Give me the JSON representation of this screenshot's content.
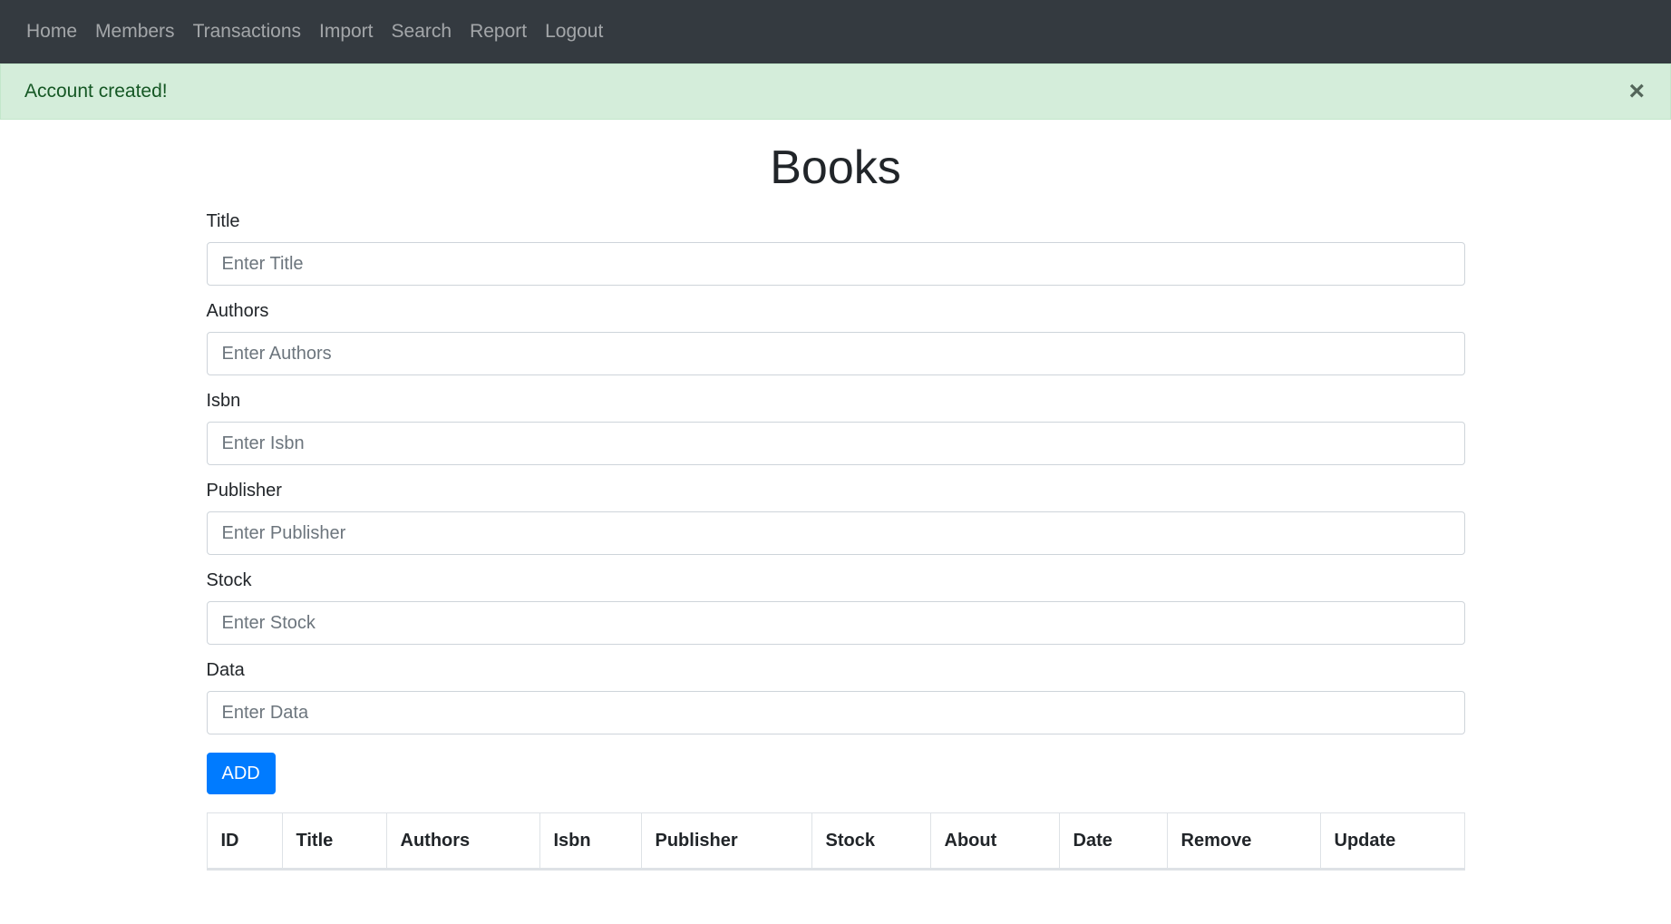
{
  "nav": {
    "items": [
      "Home",
      "Members",
      "Transactions",
      "Import",
      "Search",
      "Report",
      "Logout"
    ]
  },
  "alert": {
    "message": "Account created!",
    "close_icon": "×"
  },
  "page": {
    "title": "Books"
  },
  "form": {
    "fields": [
      {
        "label": "Title",
        "placeholder": "Enter Title",
        "value": ""
      },
      {
        "label": "Authors",
        "placeholder": "Enter Authors",
        "value": ""
      },
      {
        "label": "Isbn",
        "placeholder": "Enter Isbn",
        "value": ""
      },
      {
        "label": "Publisher",
        "placeholder": "Enter Publisher",
        "value": ""
      },
      {
        "label": "Stock",
        "placeholder": "Enter Stock",
        "value": ""
      },
      {
        "label": "Data",
        "placeholder": "Enter Data",
        "value": ""
      }
    ],
    "submit_label": "ADD"
  },
  "table": {
    "columns": [
      "ID",
      "Title",
      "Authors",
      "Isbn",
      "Publisher",
      "Stock",
      "About",
      "Date",
      "Remove",
      "Update"
    ],
    "rows": []
  },
  "colors": {
    "navbar_bg": "#343a40",
    "alert_bg": "#d4edda",
    "alert_text": "#155724",
    "primary": "#007bff"
  }
}
